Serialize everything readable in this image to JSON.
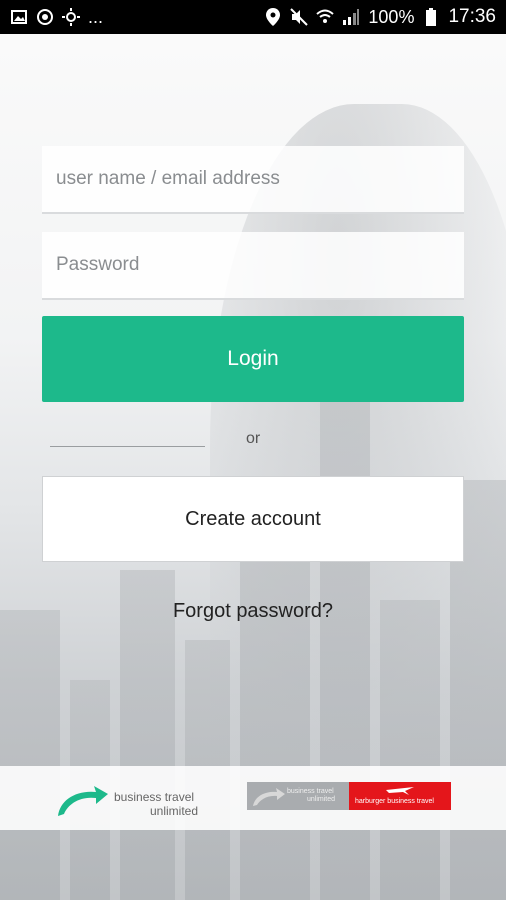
{
  "status_bar": {
    "left_icons": [
      "image-icon",
      "target-icon",
      "brightness-icon"
    ],
    "more": "...",
    "right_icons": [
      "location-icon",
      "mute-icon",
      "wifi-icon",
      "signal-icon"
    ],
    "battery": "100%",
    "time": "17:36"
  },
  "login": {
    "username_placeholder": "user name / email address",
    "password_placeholder": "Password",
    "login_label": "Login",
    "or_label": "or",
    "create_account_label": "Create account",
    "forgot_password_label": "Forgot password?"
  },
  "footer": {
    "brand_line1": "business travel",
    "brand_line2": "unlimited",
    "partner_line1": "business travel",
    "partner_line2": "unlimited",
    "partner_name": "harburger business travel"
  },
  "colors": {
    "accent": "#1db98b",
    "partner_red": "#e4161b"
  }
}
